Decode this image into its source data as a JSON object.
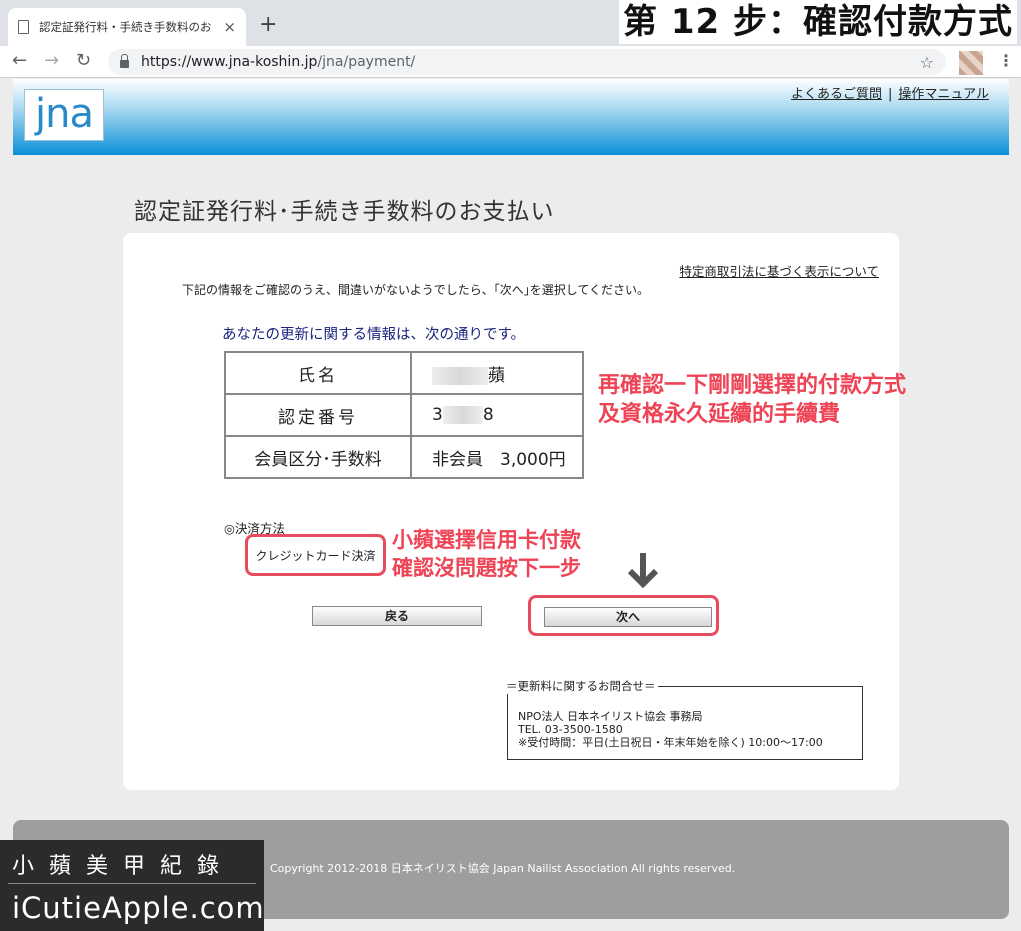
{
  "browser": {
    "tab_title": "認定証発行料・手続き手数料のお",
    "tab_close": "×",
    "new_tab": "+",
    "url_host": "https://www.jna-koshin.jp",
    "url_path": "/jna/payment/",
    "back": "←",
    "forward": "→",
    "reload": "↻",
    "star": "☆",
    "menu": "⋮"
  },
  "overlay_title": "第 12 步：確認付款方式",
  "site": {
    "logo": "jna",
    "links": [
      "よくあるご質問",
      "操作マニュアル"
    ],
    "link_separator": "|"
  },
  "page": {
    "title": "認定証発行料･手続き手数料のお支払い",
    "law_link": "特定商取引法に基づく表示について",
    "instruction": "下記の情報をご確認のうえ、間違いがないようでしたら、｢次へ｣を選択してください。",
    "info_heading": "あなたの更新に関する情報は、次の通りです。",
    "rows": [
      {
        "label": "氏名",
        "value_suffix": "蘋"
      },
      {
        "label": "認定番号",
        "value_prefix": "3",
        "value_suffix": "8"
      },
      {
        "label": "会員区分･手数料",
        "value": "非会員　3,000円"
      }
    ],
    "payment_label": "◎決済方法",
    "payment_method": "クレジットカード決済",
    "back_button": "戻る",
    "next_button": "次へ",
    "contact": {
      "title": "＝更新料に関するお問合せ＝",
      "org": "NPO法人 日本ネイリスト協会 事務局",
      "tel": "TEL. 03-3500-1580",
      "hours": "※受付時間：平日(土日祝日・年末年始を除く) 10:00〜17:00"
    }
  },
  "annotations": {
    "note1_line1": "再確認一下剛剛選擇的付款方式",
    "note1_line2": "及資格永久延續的手續費",
    "note2_line1": "小蘋選擇信用卡付款",
    "note2_line2": "確認沒問題按下一步"
  },
  "footer": {
    "copyright": "Copyright 2012-2018 日本ネイリスト協会 Japan Nailist Association All rights reserved."
  },
  "watermark": {
    "cn": "小蘋美甲紀錄",
    "en": "iCutieApple.com"
  },
  "colors": {
    "annotation": "#ee4455",
    "header_blue": "#0a8fd6"
  }
}
